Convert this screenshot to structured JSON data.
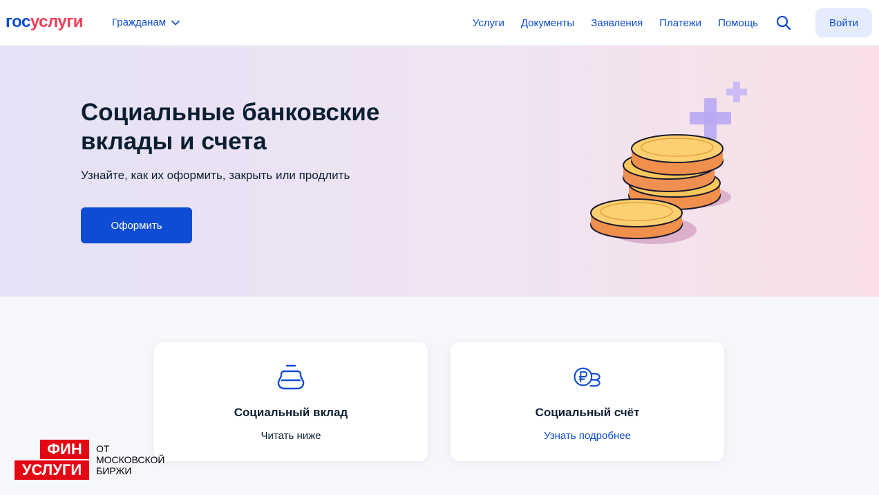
{
  "header": {
    "logo_part1": "гос",
    "logo_part2": "услуги",
    "audience_label": "Гражданам",
    "nav": [
      "Услуги",
      "Документы",
      "Заявления",
      "Платежи",
      "Помощь"
    ],
    "login_label": "Войти"
  },
  "hero": {
    "title": "Социальные банковские вклады и счета",
    "subtitle": "Узнайте, как их оформить, закрыть или продлить",
    "button_label": "Оформить"
  },
  "cards": [
    {
      "title": "Социальный вклад",
      "link": "Читать ниже"
    },
    {
      "title": "Социальный счёт",
      "link": "Узнать подробнее"
    }
  ],
  "watermark": {
    "line_fin": "ФИН",
    "line_uslugi": "УСЛУГИ",
    "caption": [
      "ОТ",
      "МОСКОВСКОЙ",
      "БИРЖИ"
    ]
  },
  "colors": {
    "brand_blue": "#0d4cd3",
    "brand_red": "#ee3f58",
    "login_bg": "#e4ecfd",
    "watermark_red": "#e30613"
  },
  "icons": {
    "search": "search-icon",
    "chevron": "chevron-down-icon",
    "card_1": "wallet-icon",
    "card_2": "ruble-coins-icon"
  }
}
